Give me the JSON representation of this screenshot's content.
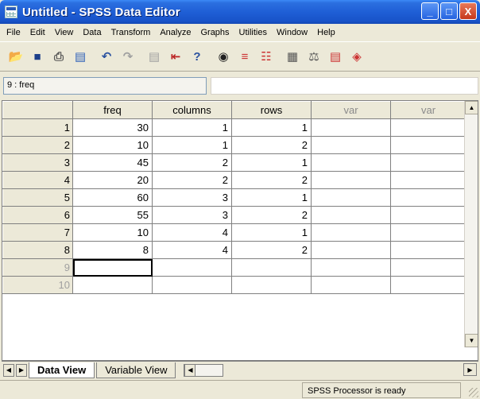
{
  "window": {
    "title": "Untitled - SPSS Data Editor",
    "controls": [
      "_",
      "□",
      "X"
    ]
  },
  "menu": [
    "File",
    "Edit",
    "View",
    "Data",
    "Transform",
    "Analyze",
    "Graphs",
    "Utilities",
    "Window",
    "Help"
  ],
  "toolbar": {
    "icons": [
      "open-folder-icon",
      "save-icon",
      "print-icon",
      "dialog-recall-icon",
      "undo-icon",
      "redo-icon",
      "goto-chart-icon",
      "goto-case-icon",
      "variables-icon",
      "find-icon",
      "insert-cases-icon",
      "insert-variable-icon",
      "split-file-icon",
      "weight-cases-icon",
      "select-cases-icon",
      "value-labels-icon"
    ]
  },
  "cell_editor": {
    "reference": "9 : freq",
    "value": ""
  },
  "grid": {
    "columns": [
      {
        "label": "freq",
        "muted": false
      },
      {
        "label": "columns",
        "muted": false
      },
      {
        "label": "rows",
        "muted": false
      },
      {
        "label": "var",
        "muted": true
      },
      {
        "label": "var",
        "muted": true
      }
    ],
    "rows": [
      {
        "num": "1",
        "cells": [
          "30",
          "1",
          "1",
          "",
          ""
        ]
      },
      {
        "num": "2",
        "cells": [
          "10",
          "1",
          "2",
          "",
          ""
        ]
      },
      {
        "num": "3",
        "cells": [
          "45",
          "2",
          "1",
          "",
          ""
        ]
      },
      {
        "num": "4",
        "cells": [
          "20",
          "2",
          "2",
          "",
          ""
        ]
      },
      {
        "num": "5",
        "cells": [
          "60",
          "3",
          "1",
          "",
          ""
        ]
      },
      {
        "num": "6",
        "cells": [
          "55",
          "3",
          "2",
          "",
          ""
        ]
      },
      {
        "num": "7",
        "cells": [
          "10",
          "4",
          "1",
          "",
          ""
        ]
      },
      {
        "num": "8",
        "cells": [
          "8",
          "4",
          "2",
          "",
          ""
        ]
      },
      {
        "num": "9",
        "cells": [
          "",
          "",
          "",
          "",
          ""
        ]
      },
      {
        "num": "10",
        "cells": [
          "",
          "",
          "",
          "",
          ""
        ]
      }
    ]
  },
  "tabs": {
    "data_view": "Data View",
    "variable_view": "Variable View"
  },
  "status": {
    "text": "SPSS Processor  is ready"
  }
}
